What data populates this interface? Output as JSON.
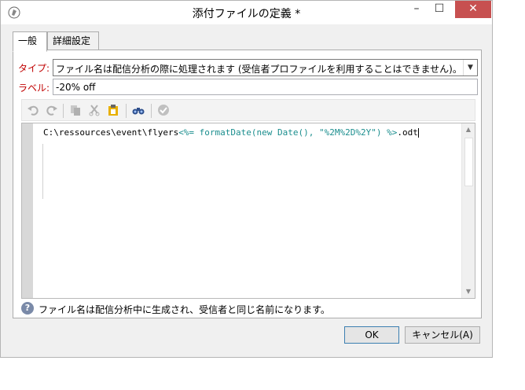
{
  "window": {
    "title": "添付ファイルの定義 *",
    "controls": {
      "minimize": "–",
      "maximize": "☐",
      "close": "✕"
    }
  },
  "tabs": [
    {
      "label": "一般",
      "active": true
    },
    {
      "label": "詳細設定",
      "active": false
    }
  ],
  "type_field": {
    "label": "タイプ:",
    "value": "ファイル名は配信分析の際に処理されます (受信者プロファイルを利用することはできません)。",
    "arrow": "▼"
  },
  "label_field": {
    "label": "ラベル:",
    "value": "-20% off"
  },
  "toolbar": {
    "icons": [
      "undo-icon",
      "redo-icon",
      "copy-icon",
      "cut-icon",
      "paste-icon",
      "binoculars-icon",
      "check-icon"
    ]
  },
  "editor": {
    "code_prefix": "C:\\ressources\\event\\flyers",
    "code_tag": "<%= formatDate(new Date(), \"%2M%2D%2Y\") %>",
    "code_suffix": ".odt"
  },
  "hint": {
    "icon": "?",
    "text": "ファイル名は配信分析中に生成され、受信者と同じ名前になります。"
  },
  "buttons": {
    "ok": "OK",
    "cancel": "キャンセル(A)"
  }
}
